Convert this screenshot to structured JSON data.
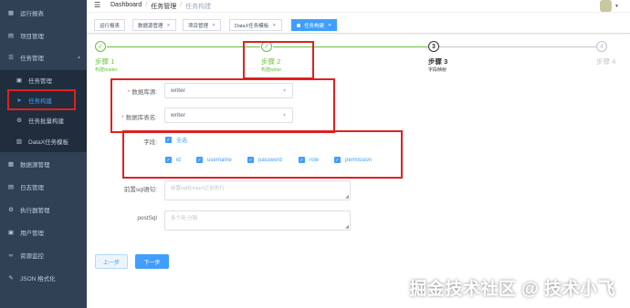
{
  "sidebar": {
    "items": [
      {
        "label": "运行报表",
        "icon": "chart-icon"
      },
      {
        "label": "项目管理",
        "icon": "project-icon"
      },
      {
        "label": "任务管理",
        "icon": "task-icon"
      },
      {
        "label": "任务管理",
        "icon": "list-icon"
      },
      {
        "label": "任务构建",
        "icon": "send-icon"
      },
      {
        "label": "任务批量构建",
        "icon": "batch-icon"
      },
      {
        "label": "DataX任务模板",
        "icon": "template-icon"
      },
      {
        "label": "数据源管理",
        "icon": "datasource-icon"
      },
      {
        "label": "日志管理",
        "icon": "log-icon"
      },
      {
        "label": "执行器管理",
        "icon": "executor-icon"
      },
      {
        "label": "用户管理",
        "icon": "user-icon"
      },
      {
        "label": "资源监控",
        "icon": "monitor-icon"
      },
      {
        "label": "JSON 格式化",
        "icon": "json-icon"
      }
    ],
    "bg_color": "#304156",
    "active_color": "#409eff"
  },
  "breadcrumb": {
    "items": [
      "Dashboard",
      "任务管理",
      "任务构建"
    ]
  },
  "tags": [
    {
      "label": "运行报表"
    },
    {
      "label": "数据源管理"
    },
    {
      "label": "项目管理"
    },
    {
      "label": "DataX任务模板"
    },
    {
      "label": "任务构建"
    }
  ],
  "steps": [
    {
      "title": "步骤 1",
      "desc": "构建reader"
    },
    {
      "title": "步骤 2",
      "desc": "构建writer"
    },
    {
      "title": "步骤 3",
      "desc": "字段映射"
    },
    {
      "title": "步骤 4",
      "desc": ""
    }
  ],
  "form": {
    "datasource_label": "数据库源:",
    "datasource_value": "writer",
    "table_label": "数据库表名:",
    "table_value": "writer",
    "fields_label": "字段:",
    "select_all": "全选",
    "fields": [
      "id",
      "username",
      "password",
      "role",
      "permission"
    ],
    "presql_label": "前置sql语句:",
    "presql_placeholder": "前置sql在insert之前执行",
    "postsql_label": "postSql",
    "postsql_placeholder": "多个用;分隔"
  },
  "buttons": {
    "prev": "上一步",
    "next": "下一步"
  },
  "watermark": "掘金技术社区 @ 技术小飞",
  "colors": {
    "primary": "#409eff",
    "success": "#67c23a",
    "annotation": "#e02020"
  }
}
